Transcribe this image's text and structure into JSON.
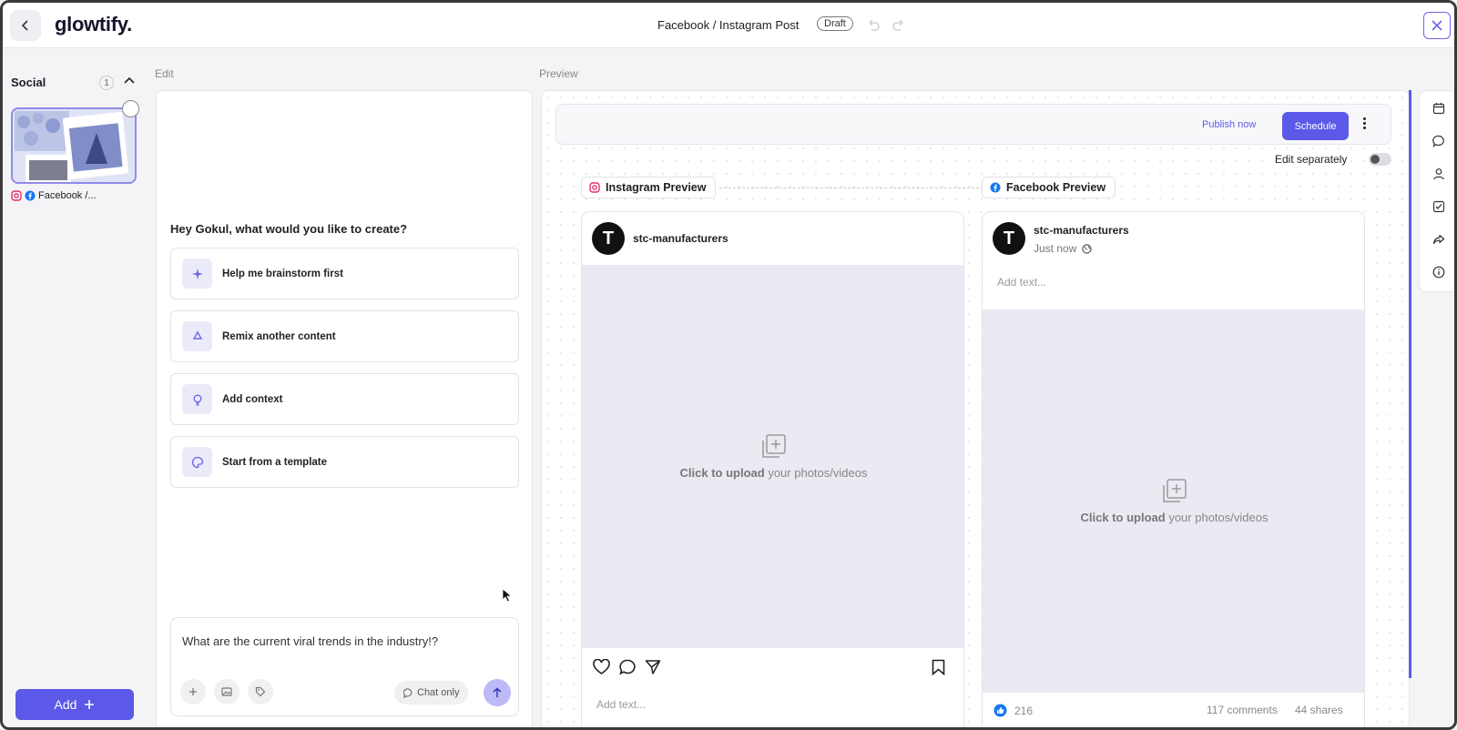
{
  "header": {
    "logo": "glowtify.",
    "title": "Facebook / Instagram Post",
    "status_badge": "Draft"
  },
  "sidebar": {
    "title": "Social",
    "count": "1",
    "item_label": "Facebook /...",
    "add_label": "Add"
  },
  "edit": {
    "section_label": "Edit",
    "greeting": "Hey Gokul, what would you like to create?",
    "options": [
      {
        "label": "Help me brainstorm first",
        "icon": "sparkle-icon"
      },
      {
        "label": "Remix another content",
        "icon": "recycle-icon"
      },
      {
        "label": "Add context",
        "icon": "lightbulb-icon"
      },
      {
        "label": "Start from a template",
        "icon": "palette-icon"
      }
    ],
    "chat_input_value": "What are the current viral trends in the industry!?",
    "chat_only_label": "Chat only"
  },
  "preview": {
    "section_label": "Preview",
    "publish_now": "Publish now",
    "schedule": "Schedule",
    "edit_separately": "Edit separately",
    "edit_separately_on": false,
    "instagram": {
      "tag": "Instagram Preview",
      "username": "stc-manufacturers",
      "upload_bold": "Click to upload",
      "upload_rest": " your photos/videos",
      "add_text": "Add text..."
    },
    "facebook": {
      "tag": "Facebook Preview",
      "username": "stc-manufacturers",
      "time": "Just now",
      "add_text": "Add text...",
      "upload_bold": "Click to upload",
      "upload_rest": " your photos/videos",
      "likes": "216",
      "comments": "117 comments",
      "shares": "44 shares"
    }
  },
  "colors": {
    "accent": "#5c59e8",
    "accent_light": "#bdbaf6",
    "instagram": "#e1306c",
    "facebook": "#1877f2"
  }
}
